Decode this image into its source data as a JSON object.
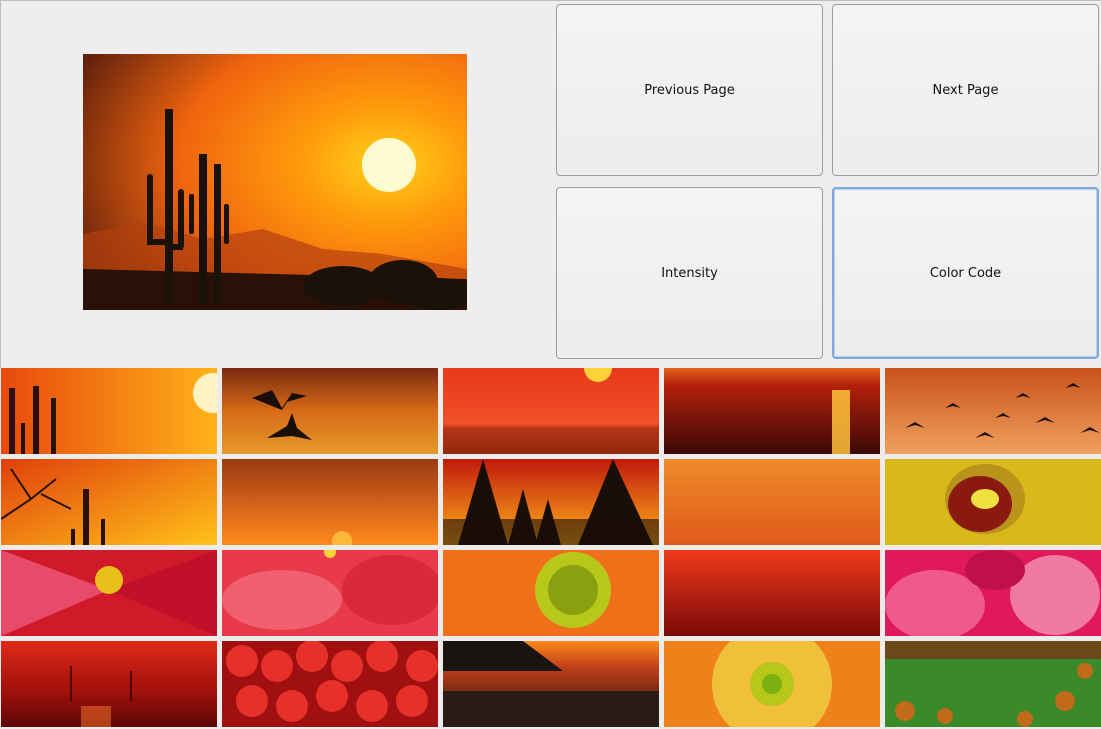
{
  "buttons": {
    "previous_page": "Previous Page",
    "next_page": "Next Page",
    "intensity": "Intensity",
    "color_code": "Color Code"
  },
  "preview": {
    "icon": "desert-sunset-cactus-image"
  },
  "thumbnails": [
    "cactus-sunset",
    "flying-cranes",
    "ocean-sun",
    "sea-sunset",
    "bird-flock",
    "tree-branches-sunset",
    "cloudy-sunset",
    "pine-trees-sunset",
    "orange-sky",
    "yellow-hibiscus",
    "red-hibiscus",
    "pink-petals",
    "orange-flower",
    "red-gradient",
    "pink-flower",
    "harbor-sunset",
    "red-berries",
    "beach-sunset",
    "yellow-daisy",
    "green-landscape"
  ]
}
